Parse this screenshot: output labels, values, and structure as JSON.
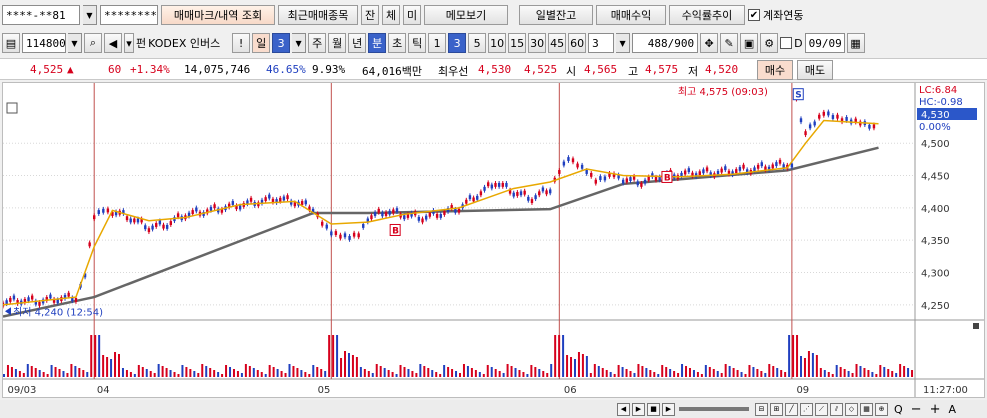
{
  "toolbar1": {
    "account_value": "****-**81",
    "password_value": "********",
    "trade_mark_btn": "매매마크/내역 조회",
    "recent_trades_btn": "최근매매종목",
    "balance_btn": "잔",
    "fill_btn": "체",
    "unfilled_btn": "미",
    "memo_btn": "메모보기",
    "daily_balance_btn": "일별잔고",
    "trade_profit_btn": "매매수익",
    "profit_trend_btn": "수익률추이",
    "account_link_label": "계좌연동",
    "account_link_checked": "✔"
  },
  "toolbar2": {
    "code_value": "114800",
    "name_prefix": "펀",
    "stock_name": "KODEX 인버스",
    "excl_btn": "!",
    "period_day": "일",
    "period_num": "3",
    "week": "주",
    "month": "월",
    "year": "년",
    "minute": "분",
    "second": "초",
    "tick": "틱",
    "intervals": [
      "1",
      "3",
      "5",
      "10",
      "15",
      "30",
      "45",
      "60"
    ],
    "selected_interval": "3",
    "count_value": "3",
    "range_value": "488",
    "range_total": "/900",
    "check_d_label": "D",
    "date_value": "09/09"
  },
  "quote": {
    "price": "4,525",
    "arrow": "▲",
    "change": "60",
    "rate": "+1.34%",
    "volume": "14,075,746",
    "ratio": "46.65%",
    "turnover_rate": "9.93%",
    "amount": "64,016백만",
    "best_label": "최우선",
    "best_ask": "4,530",
    "best_bid": "4,525",
    "open_label": "시",
    "open": "4,565",
    "high_label": "고",
    "high": "4,575",
    "low_label": "저",
    "low": "4,520",
    "buy_btn": "매수",
    "sell_btn": "매도"
  },
  "chart_data": {
    "type": "line",
    "x_labels": [
      "09/03",
      "04",
      "05",
      "06",
      "09"
    ],
    "ylim": [
      4225,
      4590
    ],
    "yticks": [
      4250,
      4300,
      4350,
      4400,
      4450,
      4500
    ],
    "ytick_labels": [
      "4,250",
      "4,300",
      "4,350",
      "4,400",
      "4,450",
      "4,500"
    ],
    "max_annotation": "최고 4,575 (09:03)",
    "min_annotation": "최저 4,240 (12:54)",
    "right_labels": {
      "lc": "LC:6.84",
      "hc": "HC:-0.98",
      "current": "4,530",
      "pct": "0.00%"
    },
    "time_label": "11:27:00",
    "markers": [
      "B",
      "B",
      "S"
    ],
    "series": [
      {
        "type": "candle_close",
        "x": [
          0,
          0.02,
          0.04,
          0.06,
          0.08,
          0.09,
          0.1,
          0.11,
          0.12,
          0.14,
          0.16,
          0.18,
          0.2,
          0.22,
          0.24,
          0.26,
          0.28,
          0.3,
          0.32,
          0.34,
          0.35,
          0.36,
          0.37,
          0.38,
          0.39,
          0.4,
          0.42,
          0.44,
          0.46,
          0.48,
          0.5,
          0.52,
          0.54,
          0.56,
          0.58,
          0.6,
          0.61,
          0.62,
          0.63,
          0.64,
          0.65,
          0.66,
          0.67,
          0.68,
          0.7,
          0.72,
          0.74,
          0.76,
          0.78,
          0.8,
          0.82,
          0.84,
          0.86,
          0.865,
          0.87,
          0.875,
          0.88,
          0.89,
          0.9,
          0.91,
          0.92,
          0.93,
          0.94,
          0.95,
          0.96
        ],
        "values": [
          4255,
          4258,
          4256,
          4260,
          4262,
          4300,
          4390,
          4400,
          4395,
          4385,
          4370,
          4375,
          4390,
          4395,
          4400,
          4405,
          4410,
          4415,
          4410,
          4400,
          4380,
          4365,
          4360,
          4358,
          4362,
          4385,
          4395,
          4390,
          4385,
          4392,
          4400,
          4420,
          4440,
          4425,
          4415,
          4430,
          4460,
          4480,
          4470,
          4460,
          4445,
          4450,
          4455,
          4445,
          4440,
          4450,
          4452,
          4455,
          4455,
          4458,
          4460,
          4465,
          4468,
          4470,
          4575,
          4540,
          4520,
          4535,
          4550,
          4545,
          4540,
          4538,
          4535,
          4530,
          4525
        ]
      },
      {
        "type": "ma_short",
        "name": "",
        "x": [
          0,
          0.08,
          0.1,
          0.12,
          0.16,
          0.2,
          0.26,
          0.32,
          0.36,
          0.4,
          0.44,
          0.5,
          0.56,
          0.6,
          0.64,
          0.68,
          0.74,
          0.8,
          0.86,
          0.88,
          0.9,
          0.96
        ],
        "values": [
          4250,
          4262,
          4340,
          4396,
          4380,
          4385,
          4405,
          4410,
          4375,
          4378,
          4390,
          4400,
          4430,
          4440,
          4460,
          4450,
          4448,
          4452,
          4462,
          4500,
          4535,
          4530
        ]
      },
      {
        "type": "ma_long",
        "name": "",
        "x": [
          0,
          0.1,
          0.34,
          0.4,
          0.6,
          0.68,
          0.86,
          0.96
        ],
        "values": [
          4232,
          4262,
          4392,
          4392,
          4398,
          4437,
          4458,
          4493
        ]
      }
    ],
    "volume": {
      "note": "volume bars",
      "day_start_spikes": [
        0.1,
        0.36,
        0.61,
        0.865
      ]
    }
  },
  "bottom": {
    "zoom_minus": "−",
    "zoom_plus": "+",
    "zoom_a": "A",
    "search": "Q"
  }
}
